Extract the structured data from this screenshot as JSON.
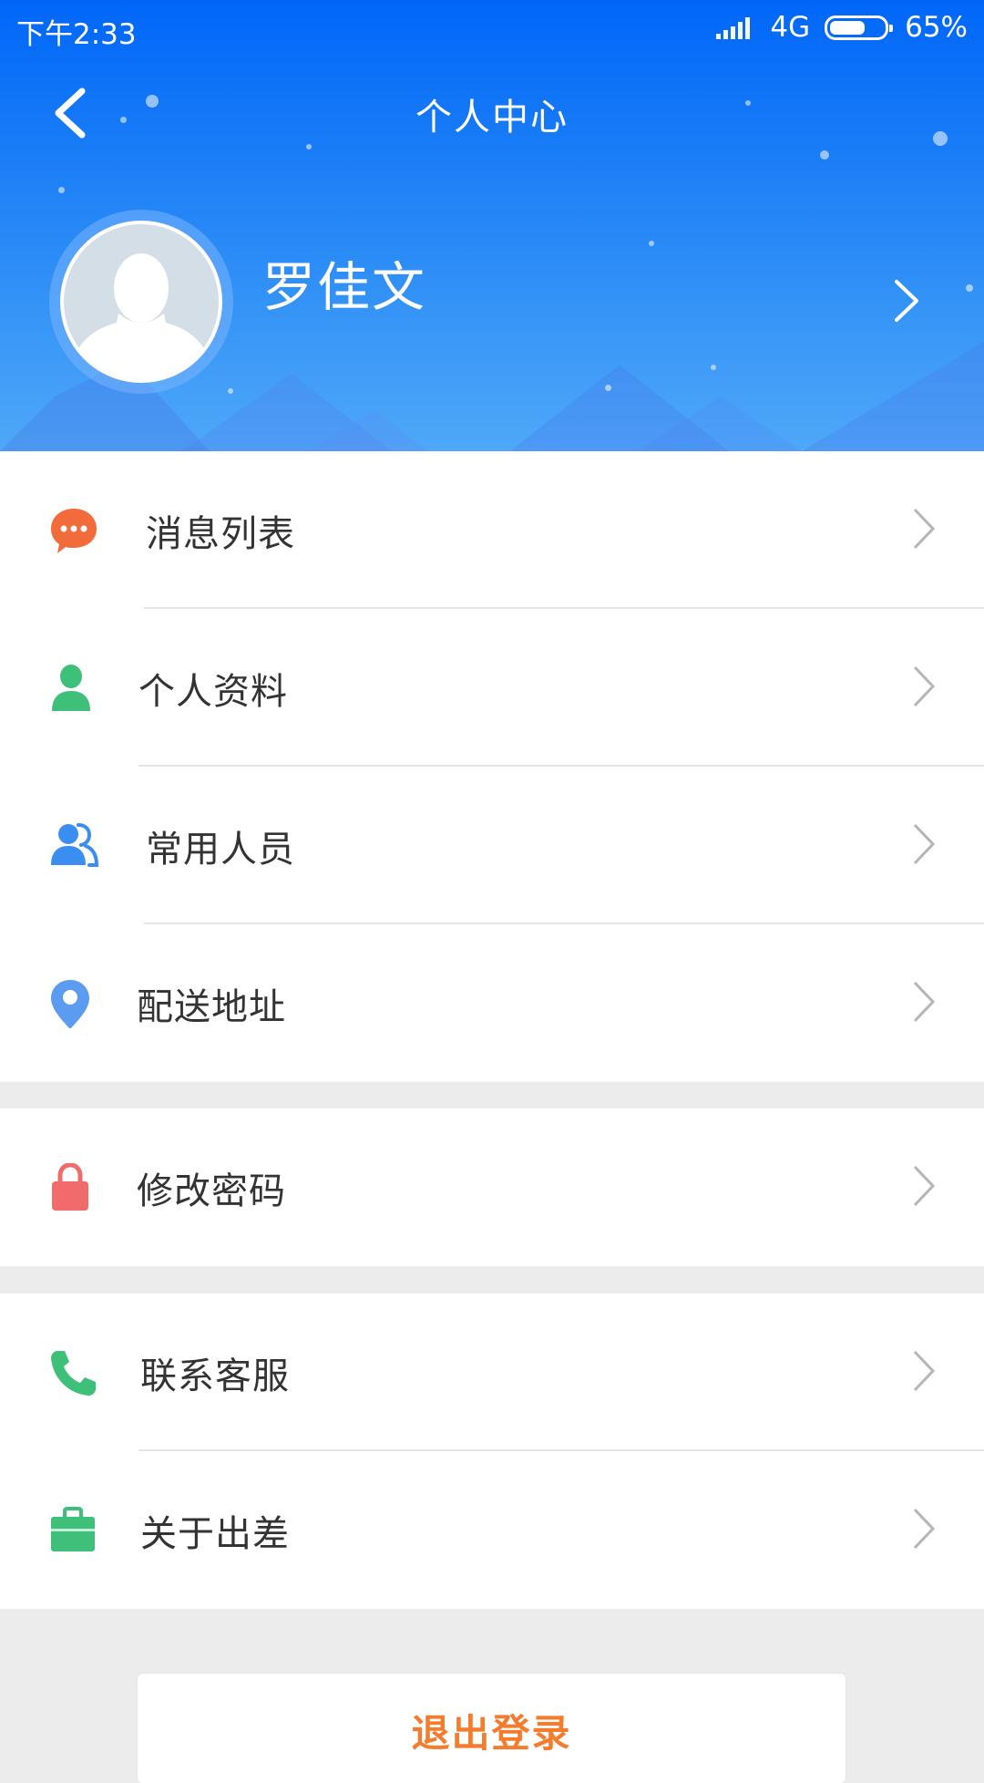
{
  "status_bar": {
    "time": "下午2:33",
    "network": "4G",
    "battery": "65%",
    "battery_level": 0.65
  },
  "nav": {
    "title": "个人中心",
    "back_icon": "chevron-left-icon"
  },
  "profile": {
    "name": "罗佳文",
    "avatar_icon": "default-avatar-icon",
    "arrow_icon": "chevron-right-icon"
  },
  "menu": {
    "group1": [
      {
        "label": "消息列表",
        "icon": "message-icon",
        "color": "#f26b3a"
      },
      {
        "label": "个人资料",
        "icon": "person-icon",
        "color": "#3fc07a"
      },
      {
        "label": "常用人员",
        "icon": "people-icon",
        "color": "#3b8ef0"
      },
      {
        "label": "配送地址",
        "icon": "location-pin-icon",
        "color": "#5b9cf0"
      }
    ],
    "group2": [
      {
        "label": "修改密码",
        "icon": "lock-icon",
        "color": "#f26b6b"
      }
    ],
    "group3": [
      {
        "label": "联系客服",
        "icon": "phone-icon",
        "color": "#3fc07a"
      },
      {
        "label": "关于出差",
        "icon": "briefcase-icon",
        "color": "#3fc07a"
      }
    ]
  },
  "logout": {
    "label": "退出登录",
    "color": "#f47c2c"
  },
  "colors": {
    "header_top": "#0066f8",
    "header_bottom": "#4fa8f8",
    "background": "#ececec"
  }
}
